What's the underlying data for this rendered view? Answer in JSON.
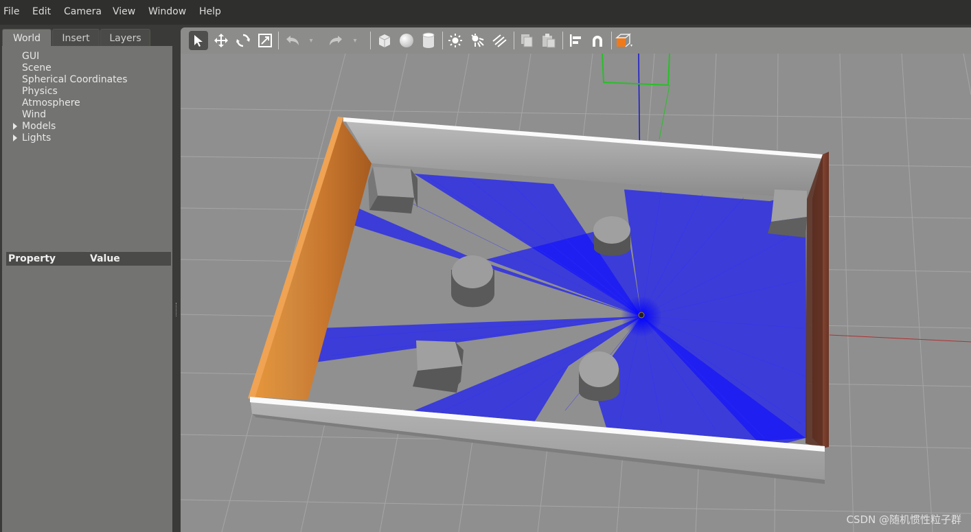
{
  "menu": [
    "File",
    "Edit",
    "Camera",
    "View",
    "Window",
    "Help"
  ],
  "tabs": [
    "World",
    "Insert",
    "Layers"
  ],
  "world_tree": [
    "GUI",
    "Scene",
    "Spherical Coordinates",
    "Physics",
    "Atmosphere",
    "Wind",
    "Models",
    "Lights"
  ],
  "property_panel": {
    "col_property": "Property",
    "col_value": "Value"
  },
  "toolbar_icons": [
    "select-arrow-icon",
    "translate-icon",
    "rotate-icon",
    "scale-icon",
    "undo-icon",
    "undo-dropdown-icon",
    "redo-icon",
    "redo-dropdown-icon",
    "box-shape-icon",
    "sphere-shape-icon",
    "cylinder-shape-icon",
    "point-light-icon",
    "spot-light-icon",
    "directional-light-icon",
    "copy-icon",
    "paste-icon",
    "align-icon",
    "snap-icon",
    "view-angle-icon"
  ],
  "colors": {
    "laser": "#1010ff",
    "accent": "#f07a1a",
    "wood": "#c9782e"
  },
  "watermark": "CSDN @随机惯性粒子群"
}
